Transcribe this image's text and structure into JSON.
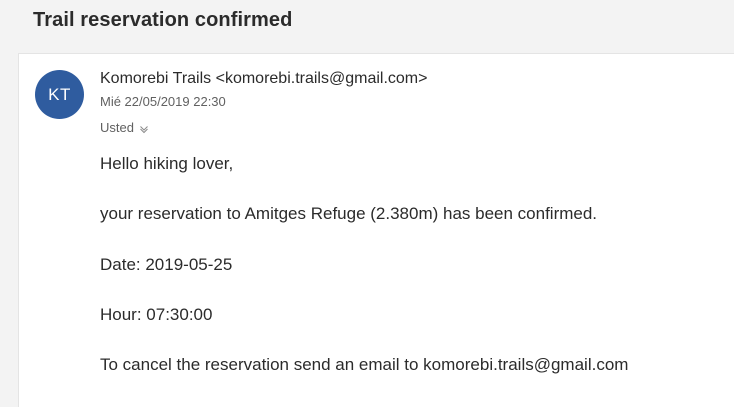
{
  "subject": "Trail reservation confirmed",
  "message": {
    "avatar_initials": "KT",
    "avatar_color": "#2f5c9f",
    "sender": "Komorebi Trails <komorebi.trails@gmail.com>",
    "date": "Mié 22/05/2019 22:30",
    "to_label": "Usted",
    "body": {
      "greeting": "Hello hiking lover,",
      "confirmation": "your reservation to Amitges Refuge (2.380m) has been confirmed.",
      "date_line": "Date: 2019-05-25",
      "hour_line": "Hour: 07:30:00",
      "cancel_line": "To cancel the reservation send an email to komorebi.trails@gmail.com"
    }
  }
}
